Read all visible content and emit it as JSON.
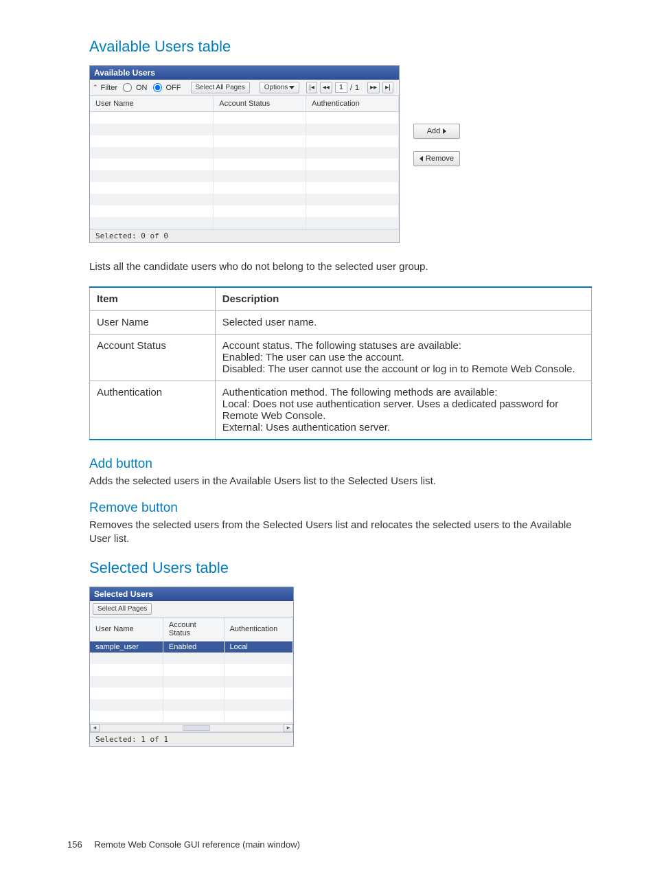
{
  "headings": {
    "available_users": "Available Users table",
    "add_button": "Add button",
    "remove_button": "Remove button",
    "selected_users": "Selected Users table"
  },
  "paragraphs": {
    "available_desc": "Lists all the candidate users who do not belong to the selected user group.",
    "add_desc": "Adds the selected users in the Available Users list to the Selected Users list.",
    "remove_desc": "Removes the selected users from the Selected Users list and relocates the selected users to the Available User list."
  },
  "available_widget": {
    "title": "Available Users",
    "filter": {
      "label": "Filter",
      "on": "ON",
      "off": "OFF"
    },
    "select_all_pages": "Select All Pages",
    "options": "Options",
    "page_current": "1",
    "page_total_prefix": "/ ",
    "page_total": "1",
    "columns": {
      "c1": "User Name",
      "c2": "Account Status",
      "c3": "Authentication"
    },
    "status": "Selected: 0  of 0"
  },
  "actions": {
    "add": "Add",
    "remove": "Remove"
  },
  "doc_table": {
    "head": {
      "item": "Item",
      "desc": "Description"
    },
    "rows": [
      {
        "item": "User Name",
        "desc": [
          "Selected user name."
        ]
      },
      {
        "item": "Account Status",
        "desc": [
          "Account status. The following statuses are available:",
          "Enabled: The user can use the account.",
          "Disabled: The user cannot use the account or log in to Remote Web Console."
        ]
      },
      {
        "item": "Authentication",
        "desc": [
          "Authentication method. The following methods are available:",
          "Local: Does not use authentication server. Uses a dedicated password for Remote Web Console.",
          "External: Uses authentication server."
        ]
      }
    ]
  },
  "selected_widget": {
    "title": "Selected Users",
    "select_all_pages": "Select All Pages",
    "columns": {
      "c1": "User Name",
      "c2": "Account Status",
      "c3": "Authentication"
    },
    "row": {
      "user": "sample_user",
      "status": "Enabled",
      "auth": "Local"
    },
    "status": "Selected: 1  of 1"
  },
  "footer": {
    "page_no": "156",
    "section": "Remote Web Console GUI reference (main window)"
  }
}
